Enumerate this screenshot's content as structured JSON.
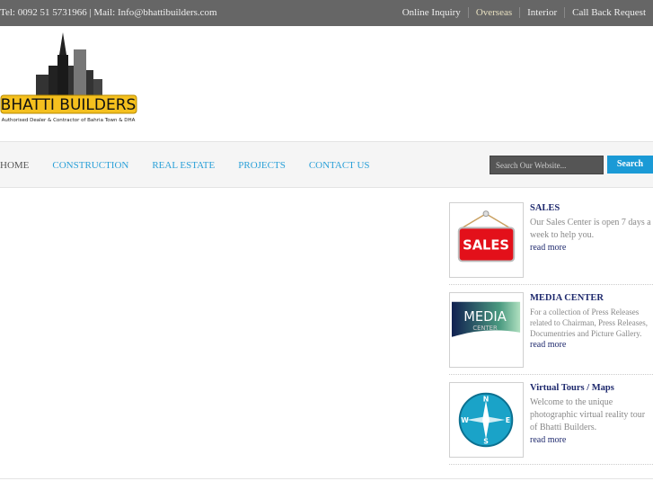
{
  "topbar": {
    "contact": "Tel: 0092 51 5731966 | Mail: Info@bhattibuilders.com",
    "links": [
      "Online Inquiry",
      "Overseas",
      "Interior",
      "Call Back Request"
    ]
  },
  "logo": {
    "name": "BHATTI BUILDERS",
    "tagline": "Authorised Dealer & Contractor of Bahria Town & DHA"
  },
  "nav": [
    "HOME",
    "CONSTRUCTION",
    "REAL ESTATE",
    "PROJECTS",
    "CONTACT US"
  ],
  "search": {
    "placeholder": "Search Our Website...",
    "button": "Search"
  },
  "sidebar": [
    {
      "title": "SALES",
      "text": "Our Sales Center is open 7 days a week to help you.",
      "link": "read more",
      "image_text": "SALES"
    },
    {
      "title": "MEDIA CENTER",
      "text": "For a collection of Press Releases related to Chairman, Press Releases, Documentries and Picture Gallery.",
      "link": "read more",
      "image_text": "MEDIA CENTER"
    },
    {
      "title": "Virtual Tours / Maps",
      "text": "Welcome to the unique photographic virtual reality tour of Bhatti Builders.",
      "link": "read more",
      "image_text": "N E S W"
    }
  ]
}
